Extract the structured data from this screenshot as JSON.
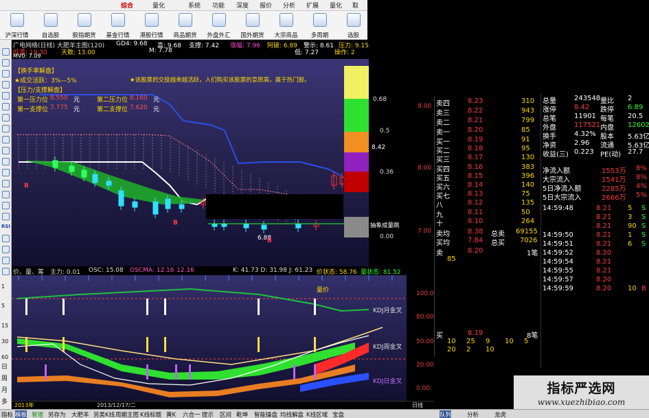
{
  "titlebar": {
    "menus": [
      "综合",
      "量化",
      "系统",
      "功能",
      "深度",
      "报价",
      "分析",
      "扩展",
      "量化",
      "取"
    ]
  },
  "toolbar": {
    "buttons": [
      {
        "label": "沪深行情",
        "icon": "market-icon"
      },
      {
        "label": "自选股",
        "icon": "dollar-icon"
      },
      {
        "label": "股指期货",
        "icon": "document-search-icon"
      },
      {
        "label": "基金行情",
        "icon": "fund-icon"
      },
      {
        "label": "港股行情",
        "icon": "hk-icon"
      },
      {
        "label": "商品期货",
        "icon": "commodity-icon"
      },
      {
        "label": "外盘外汇",
        "icon": "globe-icon"
      },
      {
        "label": "国外期货",
        "icon": "chart-icon"
      },
      {
        "label": "大宗商品",
        "icon": "cargo-icon"
      },
      {
        "label": "多周期",
        "icon": "multiperiod-icon"
      },
      {
        "label": "选股",
        "icon": "select-icon"
      }
    ]
  },
  "leftbar": {
    "numbers": [
      "1",
      "5",
      "15",
      "30",
      "60"
    ],
    "periods": [
      "日",
      "周",
      "月",
      "多"
    ],
    "rsi_label": "RSI"
  },
  "header": {
    "title": "广电网络(日线) 大肥羊主图(120)",
    "gd4": "GD4: 9.68",
    "gao": "高: 9.68",
    "low_label": "低: 9.68",
    "zhicheng": "支撑: 7.42",
    "zhangfu": "涨幅: 7.96",
    "dahong": "阿破: 6.89",
    "jingshi": "警示: 8.61",
    "yali": "压力: 9.15",
    "row2_a": "低落: 19.30",
    "row2_b": "天数: 13.00",
    "row2_c": "M: 7.78",
    "row2_d": "低: 7.27",
    "row2_e": "操作: 2",
    "row3": "MV0: 7.09"
  },
  "info_box": {
    "heading1": "【换手率解盘】",
    "line1": "★成交活跃：3%—5%",
    "line1_right": "★该股票的交投越来越活跃，人们购买该股票的意愿高，属于热门股。",
    "heading2": "【压力/支撑解盘】",
    "p1_label": "第一压力位",
    "p1_value": "8.550",
    "p2_label": "第二压力位",
    "p2_value": "8.160",
    "s1_label": "第一支撑位",
    "s1_value": "7.775",
    "s2_label": "第二支撑位",
    "s2_value": "7.620",
    "unit": "元"
  },
  "main_chart": {
    "scale_right": [
      "0.68",
      "0.5",
      "0.36",
      "0.00"
    ],
    "price_right": [
      "8.42",
      "6.88"
    ],
    "price_axis": [
      "9.00",
      "8.00",
      "7.00"
    ],
    "label_bottom": "抽象成量跳",
    "markers": [
      "B",
      "B",
      "B"
    ]
  },
  "indicator_header": {
    "left": "价、量、筹",
    "main": "主力: 0.01",
    "osc": "OSC: 15.08",
    "oscma": "OSCMA: 12.16",
    "v2": "12.16",
    "kdj": "K: 41.73  D: 31.98  J: 61.23",
    "jz": "价状态: 58.76",
    "lz": "量状态: 81.52"
  },
  "sub_chart": {
    "labels": [
      "KDJ月金叉",
      "KDJ周金叉",
      "KDJ日金叉"
    ],
    "top_label": "量价",
    "axis_right": [
      "100.00",
      "80.00",
      "50.00",
      "20.00",
      "0.00"
    ],
    "bottom_left": "2013年",
    "bottom_mid": "2013/12/17/二",
    "axis_end": "日线"
  },
  "order_book": {
    "sells": [
      {
        "name": "卖四",
        "price": "8.23",
        "vol": "310"
      },
      {
        "name": "卖三",
        "price": "8.22",
        "vol": "943"
      },
      {
        "name": "卖二",
        "price": "8.21",
        "vol": "799"
      },
      {
        "name": "卖一",
        "price": "8.20",
        "vol": "85"
      }
    ],
    "buys": [
      {
        "name": "买一",
        "price": "8.19",
        "vol": "91"
      },
      {
        "name": "买二",
        "price": "8.18",
        "vol": "95"
      },
      {
        "name": "买三",
        "price": "8.17",
        "vol": "130"
      },
      {
        "name": "买四",
        "price": "8.16",
        "vol": "383"
      },
      {
        "name": "买五",
        "price": "8.15",
        "vol": "396"
      },
      {
        "name": "买六",
        "price": "8.14",
        "vol": "140"
      },
      {
        "name": "买七",
        "price": "8.13",
        "vol": "75"
      },
      {
        "name": "八",
        "price": "8.12",
        "vol": "135"
      },
      {
        "name": "九",
        "price": "8.11",
        "vol": "50"
      },
      {
        "name": "十",
        "price": "8.10",
        "vol": "264"
      }
    ],
    "avg_sell_label": "卖均",
    "avg_sell": "8.38",
    "total_sell_label": "总卖",
    "total_sell": "69155",
    "avg_buy_label": "买均",
    "avg_buy": "7.84",
    "total_buy_label": "总买",
    "total_buy": "7026",
    "sell_row_label": "卖",
    "sell_row_price": "8.20",
    "sell_row_vol": "1笔",
    "sell_row_sub": "85",
    "buy_row_label": "买",
    "buy_row_price": "8.19",
    "buy_row_vol": "8笔",
    "buy_queue1": [
      "10",
      "25",
      "9",
      "10",
      "5"
    ],
    "buy_queue2": [
      "20",
      "2",
      "10"
    ]
  },
  "stats": [
    {
      "l": "总量",
      "v": "243548",
      "l2": "量比",
      "v2": "2"
    },
    {
      "l": "涨停",
      "v": "8.42",
      "l2": "跌停",
      "v2": "6.89"
    },
    {
      "l": "总笔",
      "v": "11901",
      "l2": "每笔",
      "v2": "20.5"
    },
    {
      "l": "外盘",
      "v": "117521",
      "l2": "内盘",
      "v2": "126027"
    },
    {
      "l": "换手",
      "v": "4.32%",
      "l2": "股本",
      "v2": "5.63亿"
    },
    {
      "l": "净资",
      "v": "2.96",
      "l2": "流通",
      "v2": "5.63亿"
    },
    {
      "l": "收益(三)",
      "v": "0.223",
      "l2": "PE(动)",
      "v2": "27.7"
    }
  ],
  "flows": [
    {
      "l": "净流入额",
      "v": "1553万",
      "p": "8%"
    },
    {
      "l": "大宗流入",
      "v": "1541万",
      "p": "8%"
    },
    {
      "l": "5日净流入额",
      "v": "2285万",
      "p": "4%"
    },
    {
      "l": "5日大宗流入",
      "v": "2666万",
      "p": "5%"
    }
  ],
  "ticks": [
    {
      "t": "14:59:48",
      "p": "8.21",
      "v": "5",
      "d": "S"
    },
    {
      "t": "",
      "p": "8.21",
      "v": "3",
      "d": "S"
    },
    {
      "t": "",
      "p": "8.21",
      "v": "90",
      "d": "S"
    },
    {
      "t": "14:59:50",
      "p": "8.21",
      "v": "1",
      "d": "S"
    },
    {
      "t": "14:59:51",
      "p": "8.21",
      "v": "6",
      "d": "S"
    },
    {
      "t": "14:59:52",
      "p": "8.20",
      "v": "",
      "d": ""
    },
    {
      "t": "14:59:54",
      "p": "8.21",
      "v": "",
      "d": ""
    },
    {
      "t": "14:59:55",
      "p": "8.21",
      "v": "",
      "d": ""
    },
    {
      "t": "14:59:57",
      "p": "8.20",
      "v": "",
      "d": ""
    },
    {
      "t": "14:59:59",
      "p": "8.20",
      "v": "10",
      "d": "B"
    }
  ],
  "bottombar": {
    "tabs": [
      "指标",
      "模板",
      "管理",
      "另存为",
      "大肥羊",
      "另类K线",
      "周期主图",
      "K线标题",
      "黄K",
      "六合一",
      "提示",
      "区间",
      "乾坤",
      "智能操盘",
      "均线解盘",
      "K线区域",
      "宝盘"
    ],
    "right_tabs": [
      "队列",
      "分析",
      "龙虎"
    ]
  },
  "watermark": {
    "title": "指标严选网",
    "url": "www.xuezhibiao.com"
  }
}
